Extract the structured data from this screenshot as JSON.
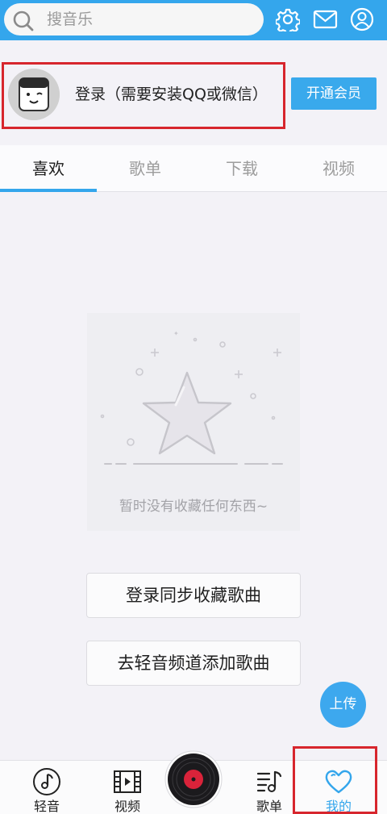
{
  "search": {
    "placeholder": "搜音乐",
    "icon": "search-icon"
  },
  "header_icons": [
    "gear-icon",
    "mail-icon",
    "user-icon"
  ],
  "account": {
    "login_text": "登录（需要安装QQ或微信）",
    "vip_button": "开通会员"
  },
  "tabs": [
    {
      "label": "喜欢",
      "active": true
    },
    {
      "label": "歌单",
      "active": false
    },
    {
      "label": "下载",
      "active": false
    },
    {
      "label": "视频",
      "active": false
    }
  ],
  "empty_state": {
    "message": "暂时没有收藏任何东西~"
  },
  "actions": {
    "login_sync": "登录同步收藏歌曲",
    "go_add": "去轻音频道添加歌曲"
  },
  "upload_button": "上传",
  "bottom_nav": [
    {
      "label": "轻音",
      "icon": "music-note-icon"
    },
    {
      "label": "视频",
      "icon": "film-icon"
    },
    {
      "label": "",
      "icon": "vinyl-disc-icon"
    },
    {
      "label": "歌单",
      "icon": "playlist-icon"
    },
    {
      "label": "我的",
      "icon": "heart-icon",
      "active": true
    }
  ],
  "colors": {
    "accent": "#34a6ec",
    "highlight_border": "#d7262d",
    "background": "#f3f2f7"
  }
}
